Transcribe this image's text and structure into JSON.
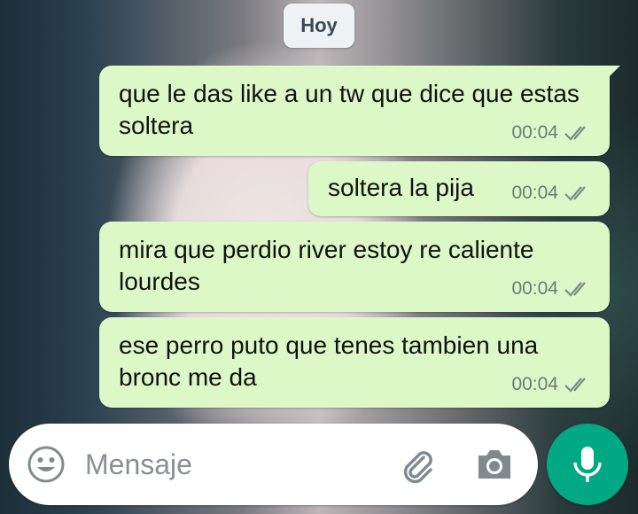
{
  "date_chip": "Hoy",
  "messages": [
    {
      "text": "que le das like a un tw que dice que estas soltera",
      "time": "00:04"
    },
    {
      "text": "soltera la pija",
      "time": "00:04"
    },
    {
      "text": "mira que perdio river estoy re caliente lourdes",
      "time": "00:04"
    },
    {
      "text": "ese perro puto que tenes tambien una bronc me da",
      "time": "00:04"
    }
  ],
  "input": {
    "placeholder": "Mensaje"
  },
  "icons": {
    "read_receipt": "double-check-icon",
    "emoji": "emoji-icon",
    "attach": "paperclip-icon",
    "camera": "camera-icon",
    "mic": "microphone-icon"
  },
  "colors": {
    "outgoing_bubble": "#dcf8c6",
    "accent": "#00a884"
  }
}
